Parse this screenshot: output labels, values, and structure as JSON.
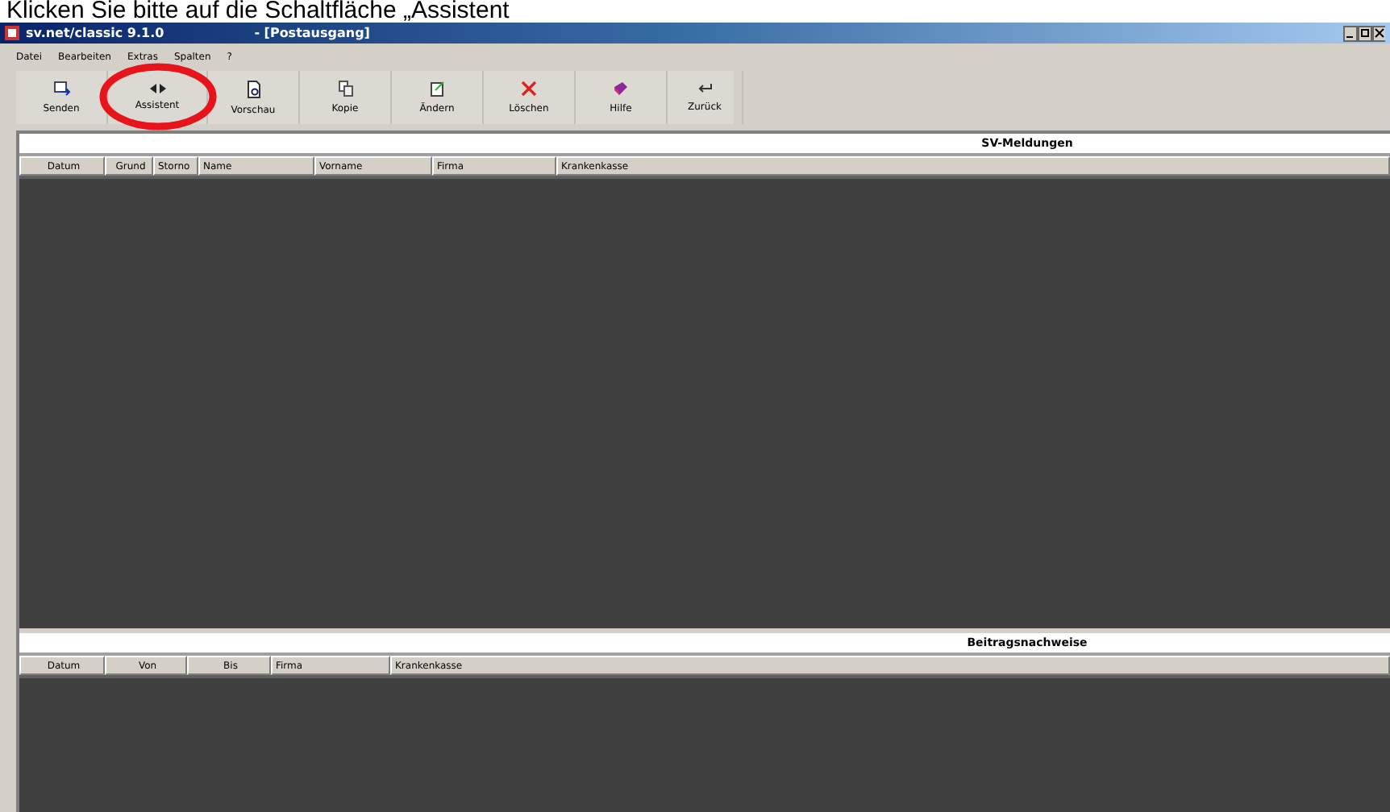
{
  "caption": "Klicken Sie bitte auf die Schaltfläche „Assistent",
  "window": {
    "title": "sv.net/classic 9.1.0",
    "document": "- [Postausgang]"
  },
  "menu": [
    "Datei",
    "Bearbeiten",
    "Extras",
    "Spalten",
    "?"
  ],
  "toolbar": [
    {
      "kind": "send",
      "label": "Senden",
      "highlighted": false
    },
    {
      "kind": "wizard",
      "label": "Assistent",
      "highlighted": true
    },
    {
      "kind": "preview",
      "label": "Vorschau",
      "highlighted": false
    },
    {
      "kind": "copy",
      "label": "Kopie",
      "highlighted": false
    },
    {
      "kind": "edit",
      "label": "Ändern",
      "highlighted": false
    },
    {
      "kind": "delete",
      "label": "Löschen",
      "highlighted": false
    },
    {
      "kind": "help",
      "label": "Hilfe",
      "highlighted": false
    },
    {
      "kind": "back",
      "label": "Zurück",
      "highlighted": false
    }
  ],
  "sections": [
    {
      "title": "SV-Meldungen",
      "columns": [
        "Datum",
        "Grund",
        "Storno",
        "Name",
        "Vorname",
        "Firma",
        "Krankenkasse"
      ]
    },
    {
      "title": "Beitragsnachweise",
      "columns": [
        "Datum",
        "Von",
        "Bis",
        "Firma",
        "Krankenkasse"
      ]
    }
  ]
}
